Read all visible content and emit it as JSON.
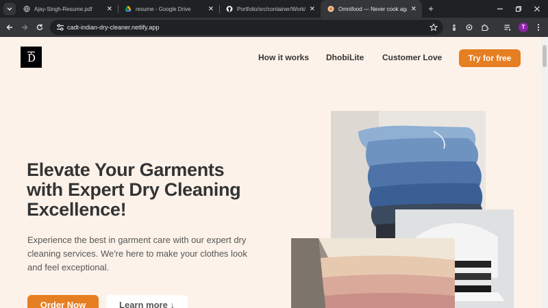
{
  "browser": {
    "tabs": [
      {
        "title": "Ajay-Singh-Resume.pdf",
        "active": false
      },
      {
        "title": "resume - Google Drive",
        "active": false
      },
      {
        "title": "Portfolio/src/container/Work/W",
        "active": false
      },
      {
        "title": "Omnifood — Never cook again!",
        "active": true
      }
    ],
    "url": "cadt-indian-dry-cleaner.netlify.app",
    "profile_initial": "T",
    "colors": {
      "frame": "#202124",
      "toolbar": "#35363a",
      "profile": "#8e24aa"
    }
  },
  "site": {
    "logo_text": "D",
    "nav": {
      "items": [
        "How it works",
        "DhobiLite",
        "Customer Love"
      ],
      "cta": "Try for free"
    },
    "hero": {
      "title": "Elevate Your Garments with Expert Dry Cleaning Excellence!",
      "description": "Experience the best in garment care with our expert dry cleaning services. We're here to make your clothes look and feel exceptional.",
      "primary_button": "Order Now",
      "secondary_button": "Learn more ↓"
    },
    "colors": {
      "background": "#fdf2e9",
      "accent": "#e67e22",
      "text": "#333333"
    }
  }
}
